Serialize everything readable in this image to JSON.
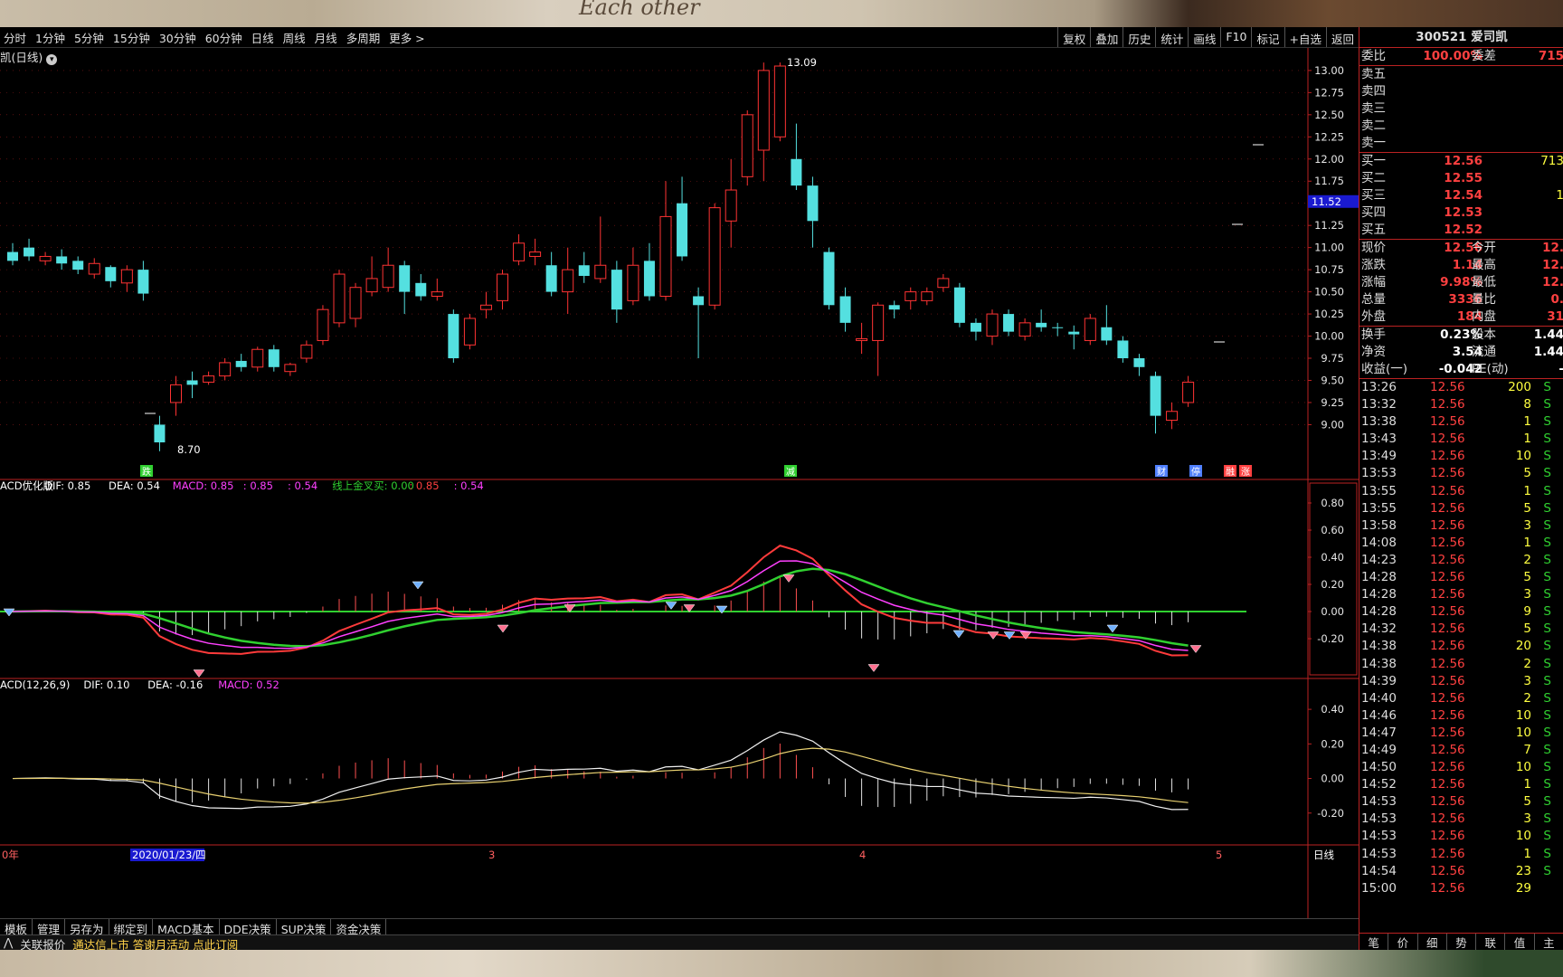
{
  "toolbar": {
    "periods": [
      "分时",
      "1分钟",
      "5分钟",
      "15分钟",
      "30分钟",
      "60分钟",
      "日线",
      "周线",
      "月线",
      "多周期",
      "更多 >"
    ],
    "right_buttons": [
      "复权",
      "叠加",
      "历史",
      "统计",
      "画线",
      "F10",
      "标记",
      "+自选",
      "返回"
    ]
  },
  "chart_header": {
    "title": "凯(日线)",
    "high_label": "13.09",
    "low_label": "8.70",
    "current_price_tag": "11.52",
    "markers": [
      "跌",
      "减",
      "财",
      "停",
      "融",
      "涨"
    ]
  },
  "price_axis": [
    "13.00",
    "12.75",
    "12.50",
    "12.25",
    "12.00",
    "11.75",
    "11.50",
    "11.25",
    "11.00",
    "10.75",
    "10.50",
    "10.25",
    "10.00",
    "9.75",
    "9.50",
    "9.25",
    "9.00"
  ],
  "indicator1": {
    "name": "ACD优化版",
    "dif_label": "DIF: 0.85",
    "dea_label": "DEA: 0.54",
    "macd_label": "MACD: 0.85",
    "v1": ": 0.85",
    "v2": ": 0.54",
    "golden_label": "线上金叉买: 0.00",
    "v3": ": 0.85",
    "v4": ": 0.54",
    "axis": [
      "0.80",
      "0.60",
      "0.40",
      "0.20",
      "0.00",
      "-0.20"
    ]
  },
  "indicator2": {
    "name": "ACD(12,26,9)",
    "dif_label": "DIF: 0.10",
    "dea_label": "DEA: -0.16",
    "macd_label": "MACD: 0.52",
    "axis": [
      "0.40",
      "0.20",
      "0.00",
      "-0.20"
    ]
  },
  "date_axis": {
    "labels": [
      "0年",
      "2020/01/23/四",
      "3",
      "4",
      "5"
    ],
    "period_label": "日线"
  },
  "bottom_tabs": [
    "模板",
    "管理",
    "另存为",
    "绑定到",
    "MACD基本",
    "DDE决策",
    "SUP决策",
    "资金决策"
  ],
  "status_bar": {
    "item1": "关联报价",
    "item2": "通达信上市 答谢月活动 点此订阅"
  },
  "quote_panel": {
    "title": "300521 爱司凯",
    "weibi_label": "委比",
    "weibi_value": "100.00%",
    "weicha_label": "委差",
    "weicha_value": "715",
    "sell_levels": [
      "卖五",
      "卖四",
      "卖三",
      "卖二",
      "卖一"
    ],
    "buy_levels": [
      {
        "label": "买一",
        "price": "12.56",
        "vol": "713"
      },
      {
        "label": "买二",
        "price": "12.55",
        "vol": ""
      },
      {
        "label": "买三",
        "price": "12.54",
        "vol": "1"
      },
      {
        "label": "买四",
        "price": "12.53",
        "vol": ""
      },
      {
        "label": "买五",
        "price": "12.52",
        "vol": ""
      }
    ],
    "stats": [
      {
        "l1": "现价",
        "v1": "12.56",
        "l2": "今开",
        "v2": "12."
      },
      {
        "l1": "涨跌",
        "v1": "1.14",
        "l2": "最高",
        "v2": "12."
      },
      {
        "l1": "涨幅",
        "v1": "9.98%",
        "l2": "最低",
        "v2": "12."
      },
      {
        "l1": "总量",
        "v1": "3336",
        "l2": "量比",
        "v2": "0."
      },
      {
        "l1": "外盘",
        "v1": "184",
        "l2": "内盘",
        "v2": "31"
      }
    ],
    "stats2": [
      {
        "l1": "换手",
        "v1": "0.23%",
        "l2": "股本",
        "v2": "1.44"
      },
      {
        "l1": "净资",
        "v1": "3.54",
        "l2": "流通",
        "v2": "1.44"
      },
      {
        "l1": "收益(一)",
        "v1": "-0.042",
        "l2": "PE(动)",
        "v2": "-"
      }
    ],
    "ticks": [
      {
        "t": "13:26",
        "p": "12.56",
        "v": "200",
        "s": "S"
      },
      {
        "t": "13:32",
        "p": "12.56",
        "v": "8",
        "s": "S"
      },
      {
        "t": "13:38",
        "p": "12.56",
        "v": "1",
        "s": "S"
      },
      {
        "t": "13:43",
        "p": "12.56",
        "v": "1",
        "s": "S"
      },
      {
        "t": "13:49",
        "p": "12.56",
        "v": "10",
        "s": "S"
      },
      {
        "t": "13:53",
        "p": "12.56",
        "v": "5",
        "s": "S"
      },
      {
        "t": "13:55",
        "p": "12.56",
        "v": "1",
        "s": "S"
      },
      {
        "t": "13:55",
        "p": "12.56",
        "v": "5",
        "s": "S"
      },
      {
        "t": "13:58",
        "p": "12.56",
        "v": "3",
        "s": "S"
      },
      {
        "t": "14:08",
        "p": "12.56",
        "v": "1",
        "s": "S"
      },
      {
        "t": "14:23",
        "p": "12.56",
        "v": "2",
        "s": "S"
      },
      {
        "t": "14:28",
        "p": "12.56",
        "v": "5",
        "s": "S"
      },
      {
        "t": "14:28",
        "p": "12.56",
        "v": "3",
        "s": "S"
      },
      {
        "t": "14:28",
        "p": "12.56",
        "v": "9",
        "s": "S"
      },
      {
        "t": "14:32",
        "p": "12.56",
        "v": "5",
        "s": "S"
      },
      {
        "t": "14:38",
        "p": "12.56",
        "v": "20",
        "s": "S"
      },
      {
        "t": "14:38",
        "p": "12.56",
        "v": "2",
        "s": "S"
      },
      {
        "t": "14:39",
        "p": "12.56",
        "v": "3",
        "s": "S"
      },
      {
        "t": "14:40",
        "p": "12.56",
        "v": "2",
        "s": "S"
      },
      {
        "t": "14:46",
        "p": "12.56",
        "v": "10",
        "s": "S"
      },
      {
        "t": "14:47",
        "p": "12.56",
        "v": "10",
        "s": "S"
      },
      {
        "t": "14:49",
        "p": "12.56",
        "v": "7",
        "s": "S"
      },
      {
        "t": "14:50",
        "p": "12.56",
        "v": "10",
        "s": "S"
      },
      {
        "t": "14:52",
        "p": "12.56",
        "v": "1",
        "s": "S"
      },
      {
        "t": "14:53",
        "p": "12.56",
        "v": "5",
        "s": "S"
      },
      {
        "t": "14:53",
        "p": "12.56",
        "v": "3",
        "s": "S"
      },
      {
        "t": "14:53",
        "p": "12.56",
        "v": "10",
        "s": "S"
      },
      {
        "t": "14:53",
        "p": "12.56",
        "v": "1",
        "s": "S"
      },
      {
        "t": "14:54",
        "p": "12.56",
        "v": "23",
        "s": "S"
      },
      {
        "t": "15:00",
        "p": "12.56",
        "v": "29",
        "s": ""
      }
    ],
    "bottom_buttons": [
      "笔",
      "价",
      "细",
      "势",
      "联",
      "值",
      "主"
    ]
  },
  "decor": {
    "top_text": "Each other"
  },
  "colors": {
    "up": "#ff3333",
    "down": "#54e0e0",
    "ma_green": "#30d030",
    "ma_red": "#ff3b3b",
    "ma_magenta": "#ff40ff",
    "grid": "#8b1a1a",
    "background": "#000000"
  },
  "chart_data": {
    "type": "candlestick",
    "price_range": [
      8.7,
      13.09
    ],
    "candles": [
      {
        "o": 10.95,
        "c": 10.85,
        "h": 11.05,
        "l": 10.8
      },
      {
        "o": 11.0,
        "c": 10.9,
        "h": 11.1,
        "l": 10.85
      },
      {
        "o": 10.85,
        "c": 10.9,
        "h": 10.95,
        "l": 10.8
      },
      {
        "o": 10.9,
        "c": 10.82,
        "h": 10.98,
        "l": 10.75
      },
      {
        "o": 10.85,
        "c": 10.75,
        "h": 10.9,
        "l": 10.7
      },
      {
        "o": 10.7,
        "c": 10.82,
        "h": 10.88,
        "l": 10.65
      },
      {
        "o": 10.78,
        "c": 10.62,
        "h": 10.8,
        "l": 10.55
      },
      {
        "o": 10.6,
        "c": 10.75,
        "h": 10.8,
        "l": 10.5
      },
      {
        "o": 10.75,
        "c": 10.48,
        "h": 10.85,
        "l": 10.4
      },
      {
        "o": 9.0,
        "c": 8.8,
        "h": 9.1,
        "l": 8.7
      },
      {
        "o": 9.25,
        "c": 9.45,
        "h": 9.55,
        "l": 9.1
      },
      {
        "o": 9.5,
        "c": 9.45,
        "h": 9.6,
        "l": 9.3
      },
      {
        "o": 9.48,
        "c": 9.55,
        "h": 9.6,
        "l": 9.45
      },
      {
        "o": 9.55,
        "c": 9.7,
        "h": 9.75,
        "l": 9.5
      },
      {
        "o": 9.72,
        "c": 9.65,
        "h": 9.8,
        "l": 9.6
      },
      {
        "o": 9.65,
        "c": 9.85,
        "h": 9.88,
        "l": 9.6
      },
      {
        "o": 9.85,
        "c": 9.65,
        "h": 9.9,
        "l": 9.6
      },
      {
        "o": 9.6,
        "c": 9.68,
        "h": 9.7,
        "l": 9.55
      },
      {
        "o": 9.75,
        "c": 9.9,
        "h": 9.95,
        "l": 9.7
      },
      {
        "o": 9.95,
        "c": 10.3,
        "h": 10.35,
        "l": 9.9
      },
      {
        "o": 10.15,
        "c": 10.7,
        "h": 10.75,
        "l": 10.1
      },
      {
        "o": 10.2,
        "c": 10.55,
        "h": 10.6,
        "l": 10.1
      },
      {
        "o": 10.5,
        "c": 10.65,
        "h": 10.9,
        "l": 10.45
      },
      {
        "o": 10.55,
        "c": 10.8,
        "h": 11.0,
        "l": 10.5
      },
      {
        "o": 10.8,
        "c": 10.5,
        "h": 10.85,
        "l": 10.25
      },
      {
        "o": 10.6,
        "c": 10.45,
        "h": 10.7,
        "l": 10.4
      },
      {
        "o": 10.45,
        "c": 10.5,
        "h": 10.65,
        "l": 10.4
      },
      {
        "o": 10.25,
        "c": 9.75,
        "h": 10.3,
        "l": 9.7
      },
      {
        "o": 9.9,
        "c": 10.2,
        "h": 10.25,
        "l": 9.85
      },
      {
        "o": 10.3,
        "c": 10.35,
        "h": 10.5,
        "l": 10.2
      },
      {
        "o": 10.4,
        "c": 10.7,
        "h": 10.75,
        "l": 10.3
      },
      {
        "o": 10.85,
        "c": 11.05,
        "h": 11.15,
        "l": 10.8
      },
      {
        "o": 10.9,
        "c": 10.95,
        "h": 11.1,
        "l": 10.8
      },
      {
        "o": 10.8,
        "c": 10.5,
        "h": 10.95,
        "l": 10.45
      },
      {
        "o": 10.5,
        "c": 10.75,
        "h": 11.0,
        "l": 10.25
      },
      {
        "o": 10.8,
        "c": 10.68,
        "h": 10.95,
        "l": 10.6
      },
      {
        "o": 10.65,
        "c": 10.8,
        "h": 11.35,
        "l": 10.6
      },
      {
        "o": 10.75,
        "c": 10.3,
        "h": 10.85,
        "l": 10.15
      },
      {
        "o": 10.4,
        "c": 10.8,
        "h": 11.0,
        "l": 10.35
      },
      {
        "o": 10.85,
        "c": 10.45,
        "h": 11.05,
        "l": 10.4
      },
      {
        "o": 10.45,
        "c": 11.35,
        "h": 11.75,
        "l": 10.4
      },
      {
        "o": 11.5,
        "c": 10.9,
        "h": 11.8,
        "l": 10.85
      },
      {
        "o": 10.45,
        "c": 10.35,
        "h": 10.55,
        "l": 9.75
      },
      {
        "o": 10.35,
        "c": 11.45,
        "h": 11.5,
        "l": 10.3
      },
      {
        "o": 11.3,
        "c": 11.65,
        "h": 12.0,
        "l": 11.0
      },
      {
        "o": 11.8,
        "c": 12.5,
        "h": 12.55,
        "l": 11.7
      },
      {
        "o": 12.1,
        "c": 13.0,
        "h": 13.09,
        "l": 11.75
      },
      {
        "o": 12.25,
        "c": 13.05,
        "h": 13.09,
        "l": 12.2
      },
      {
        "o": 12.0,
        "c": 11.7,
        "h": 12.4,
        "l": 11.65
      },
      {
        "o": 11.7,
        "c": 11.3,
        "h": 11.8,
        "l": 11.0
      },
      {
        "o": 10.95,
        "c": 10.35,
        "h": 11.0,
        "l": 10.3
      },
      {
        "o": 10.45,
        "c": 10.15,
        "h": 10.55,
        "l": 10.05
      },
      {
        "o": 9.95,
        "c": 9.97,
        "h": 10.15,
        "l": 9.8
      },
      {
        "o": 9.95,
        "c": 10.35,
        "h": 10.38,
        "l": 9.55
      },
      {
        "o": 10.35,
        "c": 10.3,
        "h": 10.4,
        "l": 10.2
      },
      {
        "o": 10.4,
        "c": 10.5,
        "h": 10.55,
        "l": 10.3
      },
      {
        "o": 10.4,
        "c": 10.5,
        "h": 10.55,
        "l": 10.35
      },
      {
        "o": 10.55,
        "c": 10.65,
        "h": 10.7,
        "l": 10.5
      },
      {
        "o": 10.55,
        "c": 10.15,
        "h": 10.6,
        "l": 10.1
      },
      {
        "o": 10.15,
        "c": 10.05,
        "h": 10.2,
        "l": 9.95
      },
      {
        "o": 10.0,
        "c": 10.25,
        "h": 10.3,
        "l": 9.9
      },
      {
        "o": 10.25,
        "c": 10.05,
        "h": 10.3,
        "l": 10.0
      },
      {
        "o": 10.0,
        "c": 10.15,
        "h": 10.2,
        "l": 9.95
      },
      {
        "o": 10.15,
        "c": 10.1,
        "h": 10.3,
        "l": 10.05
      },
      {
        "o": 10.1,
        "c": 10.09,
        "h": 10.15,
        "l": 10.0
      },
      {
        "o": 10.05,
        "c": 10.02,
        "h": 10.12,
        "l": 9.85
      },
      {
        "o": 9.95,
        "c": 10.2,
        "h": 10.25,
        "l": 9.9
      },
      {
        "o": 10.1,
        "c": 9.95,
        "h": 10.35,
        "l": 9.9
      },
      {
        "o": 9.95,
        "c": 9.75,
        "h": 10.0,
        "l": 9.7
      },
      {
        "o": 9.75,
        "c": 9.65,
        "h": 9.8,
        "l": 9.55
      },
      {
        "o": 9.55,
        "c": 9.1,
        "h": 9.6,
        "l": 8.9
      },
      {
        "o": 9.05,
        "c": 9.15,
        "h": 9.25,
        "l": 8.95
      },
      {
        "o": 9.25,
        "c": 9.48,
        "h": 9.55,
        "l": 9.2
      }
    ],
    "macd1": {
      "zero_index": 0,
      "range": [
        -0.5,
        0.9
      ]
    },
    "macd2": {
      "range": [
        -0.4,
        0.5
      ]
    }
  }
}
